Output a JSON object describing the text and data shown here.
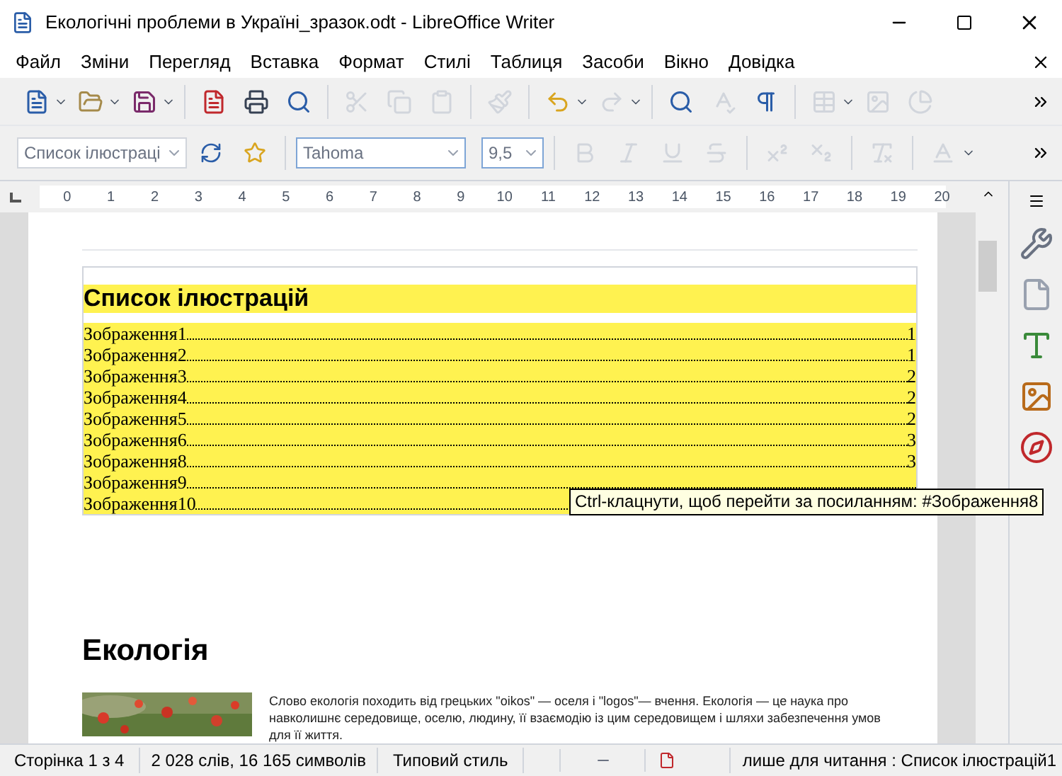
{
  "window": {
    "title": "Екологічні проблеми в Україні_зразок.odt - LibreOffice Writer"
  },
  "menu": [
    "Файл",
    "Зміни",
    "Перегляд",
    "Вставка",
    "Формат",
    "Стилі",
    "Таблиця",
    "Засоби",
    "Вікно",
    "Довідка"
  ],
  "formatting": {
    "paragraph_style": "Список ілюстраці",
    "font": "Tahoma",
    "size": "9,5"
  },
  "ruler": [
    "0",
    "1",
    "2",
    "3",
    "4",
    "5",
    "6",
    "7",
    "8",
    "9",
    "10",
    "11",
    "12",
    "13",
    "14",
    "15",
    "16",
    "17",
    "18",
    "19",
    "20"
  ],
  "document": {
    "index_title": "Список ілюстрацій",
    "entries": [
      {
        "label": "Зображення1",
        "page": "1"
      },
      {
        "label": "Зображення2",
        "page": "1"
      },
      {
        "label": "Зображення3",
        "page": "2"
      },
      {
        "label": "Зображення4",
        "page": "2"
      },
      {
        "label": "Зображення5",
        "page": "2"
      },
      {
        "label": "Зображення6",
        "page": "3"
      },
      {
        "label": "Зображення8",
        "page": "3"
      },
      {
        "label": "Зображення9"
      },
      {
        "label": "Зображення10"
      }
    ],
    "heading": "Екологія",
    "paragraph": "Слово екологія походить від грецьких \"oikos\" — оселя і \"logos\"— вчення. Екологія — це наука про навколишнє середовище, оселю, людину, її взаємодію із цим середовищем і шляхи забезпечення умов для її життя."
  },
  "tooltip": "Ctrl-клацнути, щоб перейти за посиланням: #Зображення8",
  "status_bar": [
    "Сторінка 1 з 4",
    "2 028 слів, 16 165 символів",
    "Типовий стиль",
    "лише для читання : Список ілюстрацій1"
  ]
}
